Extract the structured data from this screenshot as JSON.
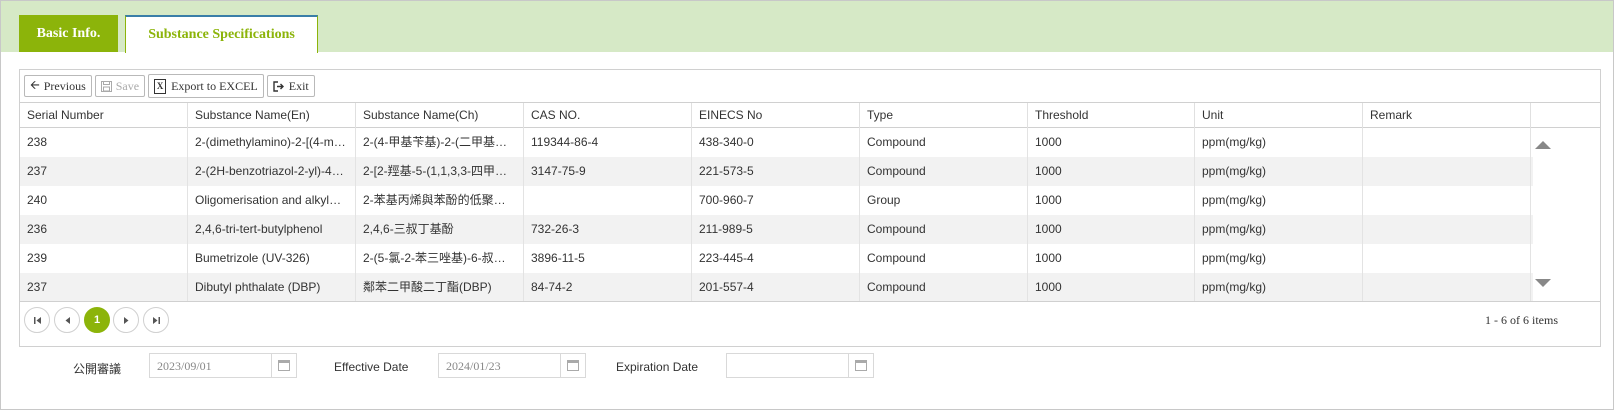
{
  "tabs": [
    {
      "label": "Basic Info."
    },
    {
      "label": "Substance Specifications"
    }
  ],
  "toolbar": {
    "previous_label": "Previous",
    "save_label": "Save",
    "export_label": "Export to EXCEL",
    "exit_label": "Exit"
  },
  "table": {
    "columns": [
      "Serial Number",
      "Substance Name(En)",
      "Substance Name(Ch)",
      "CAS NO.",
      "EINECS No",
      "Type",
      "Threshold",
      "Unit",
      "Remark"
    ],
    "rows": [
      [
        "238",
        "2-(dimethylamino)-2-[(4-m…",
        "2-(4-甲基苄基)-2-(二甲基…",
        "119344-86-4",
        "438-340-0",
        "Compound",
        "1000",
        "ppm(mg/kg)",
        ""
      ],
      [
        "237",
        "2-(2H-benzotriazol-2-yl)-4…",
        "2-[2-羥基-5-(1,1,3,3-四甲…",
        "3147-75-9",
        "221-573-5",
        "Compound",
        "1000",
        "ppm(mg/kg)",
        ""
      ],
      [
        "240",
        "Oligomerisation and alkyl…",
        "2-苯基丙烯與苯酚的低聚…",
        "",
        "700-960-7",
        "Group",
        "1000",
        "ppm(mg/kg)",
        ""
      ],
      [
        "236",
        "2,4,6-tri-tert-butylphenol",
        "2,4,6-三叔丁基酚",
        "732-26-3",
        "211-989-5",
        "Compound",
        "1000",
        "ppm(mg/kg)",
        ""
      ],
      [
        "239",
        "Bumetrizole (UV-326)",
        "2-(5-氯-2-苯三唑基)-6-叔…",
        "3896-11-5",
        "223-445-4",
        "Compound",
        "1000",
        "ppm(mg/kg)",
        ""
      ],
      [
        "237",
        "Dibutyl phthalate (DBP)",
        "鄰苯二甲酸二丁酯(DBP)",
        "84-74-2",
        "201-557-4",
        "Compound",
        "1000",
        "ppm(mg/kg)",
        ""
      ]
    ]
  },
  "pager": {
    "current_page": "1",
    "info": "1 - 6 of 6 items"
  },
  "dates": {
    "public_review_label": "公開審議",
    "public_review_value": "2023/09/01",
    "effective_label": "Effective Date",
    "effective_value": "2024/01/23",
    "expiration_label": "Expiration Date",
    "expiration_value": ""
  },
  "colors": {
    "accent": "#8cb40a",
    "tabbar_bg": "#d6e9c6"
  }
}
